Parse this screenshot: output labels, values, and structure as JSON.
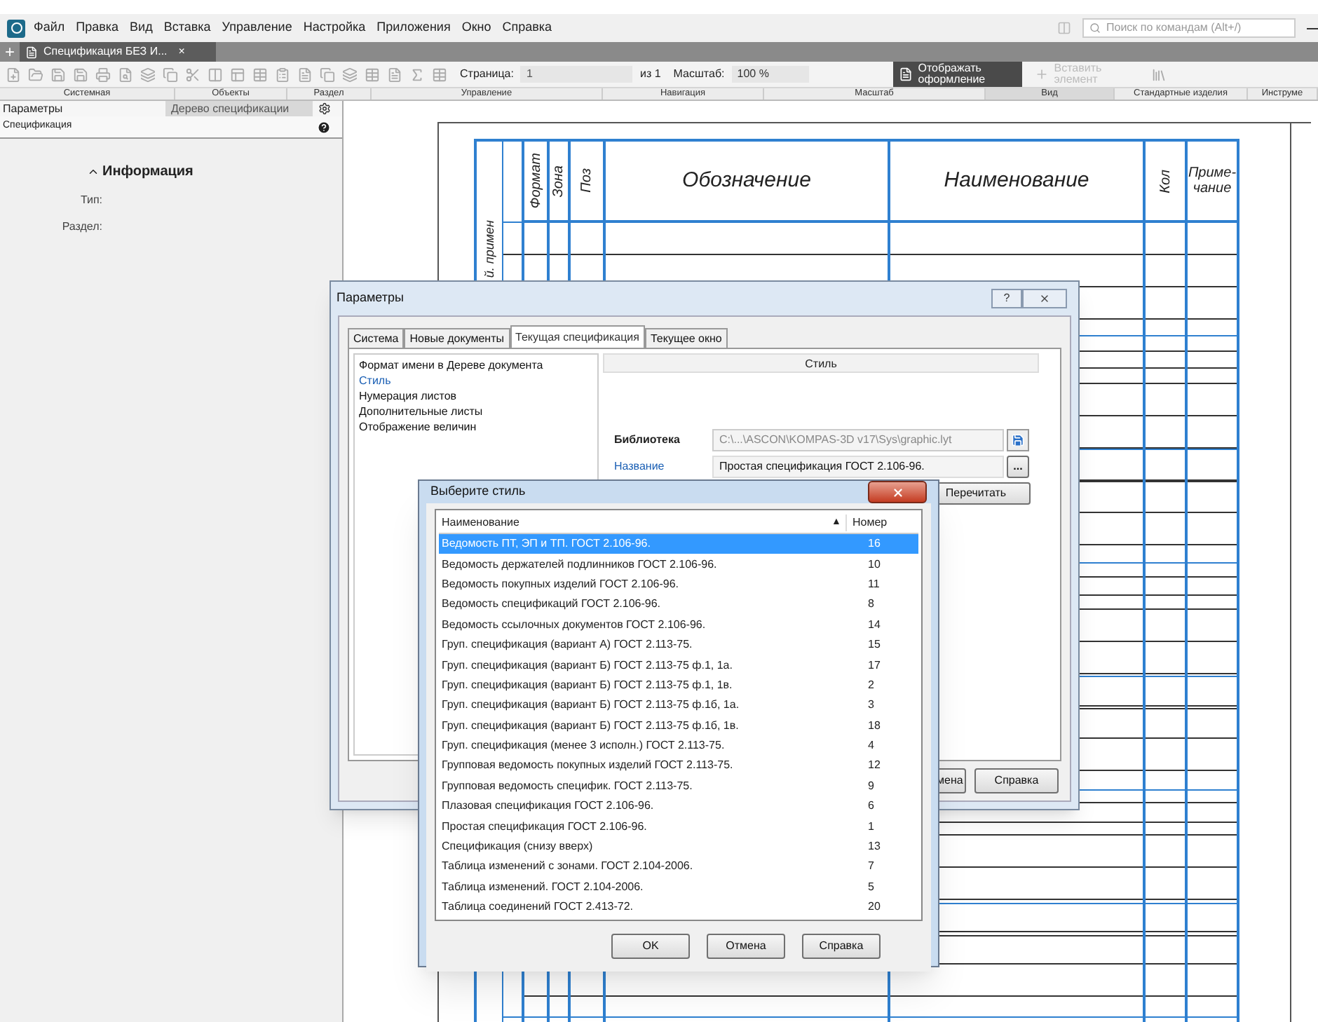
{
  "menu": [
    "Файл",
    "Правка",
    "Вид",
    "Вставка",
    "Управление",
    "Настройка",
    "Приложения",
    "Окно",
    "Справка"
  ],
  "search": {
    "placeholder": "Поиск по командам (Alt+/)"
  },
  "new_tab": "+",
  "document_tab": {
    "label": "Спецификация БЕЗ И...",
    "close": "×",
    "selected": true
  },
  "toolbar": {
    "page_label": "Страница:",
    "page_value": "1",
    "page_total": "из 1",
    "scale_label": "Масштаб:",
    "scale_value": "100 %",
    "show_design": {
      "label": "Отображать оформление",
      "on": true
    },
    "insert_element": {
      "label": "Вставить элемент",
      "disabled": true
    },
    "groups": [
      "Системная",
      "Объекты",
      "Раздел",
      "Управление",
      "Навигация",
      "Масштаб",
      "Вид",
      "Стандартные изделия",
      "Инструме"
    ]
  },
  "left_panel": {
    "title": "Параметры",
    "tree_tab": "Дерево спецификации",
    "object": "Спецификация",
    "section": "Информация",
    "fields": [
      "Тип:",
      "Раздел:"
    ]
  },
  "sheet": {
    "side_label": "й. примен",
    "columns": [
      {
        "kind": "vertical",
        "lines": [
          "Формат"
        ]
      },
      {
        "kind": "vertical",
        "lines": [
          "Зона"
        ]
      },
      {
        "kind": "vertical",
        "lines": [
          "Поз"
        ]
      },
      {
        "kind": "horizontal",
        "lines": [
          "Обозначение"
        ]
      },
      {
        "kind": "horizontal",
        "lines": [
          "Наименование"
        ]
      },
      {
        "kind": "vertical",
        "lines": [
          "Кол"
        ]
      },
      {
        "kind": "horizontal",
        "lines": [
          "Приме-",
          "чание"
        ]
      }
    ]
  },
  "parameters_dialog": {
    "title": "Параметры",
    "help": "?",
    "tabs": [
      {
        "label": "Система",
        "selected": false
      },
      {
        "label": "Новые документы",
        "selected": false
      },
      {
        "label": "Текущая спецификация",
        "selected": true
      },
      {
        "label": "Текущее окно",
        "selected": false
      }
    ],
    "tree": [
      {
        "label": "Формат имени в Дереве документа",
        "selected": false
      },
      {
        "label": "Стиль",
        "selected": true
      },
      {
        "label": "Нумерация листов",
        "selected": false
      },
      {
        "label": "Дополнительные листы",
        "selected": false
      },
      {
        "label": "Отображение величин",
        "selected": false
      }
    ],
    "section_title": "Стиль",
    "library": {
      "label": "Библиотека",
      "value": "C:\\...\\ASCON\\KOMPAS-3D v17\\Sys\\graphic.lyt"
    },
    "name": {
      "label": "Название",
      "value": "Простая спецификация ГОСТ 2.106-96.",
      "button": "..."
    },
    "reread": "Перечитать",
    "buttons": [
      "мена",
      "Справка"
    ]
  },
  "style_dialog": {
    "title": "Выберите стиль",
    "columns": [
      "Наименование",
      "Номер"
    ],
    "sort": "▲",
    "rows": [
      {
        "name": "Ведомость ПТ, ЭП и ТП.  ГОСТ 2.106-96.",
        "number": "16",
        "selected": true
      },
      {
        "name": "Ведомость держателей подлинников ГОСТ 2.106-96.",
        "number": "10",
        "selected": false
      },
      {
        "name": "Ведомость покупных изделий ГОСТ 2.106-96.",
        "number": "11",
        "selected": false
      },
      {
        "name": "Ведомость спецификаций ГОСТ 2.106-96.",
        "number": "8",
        "selected": false
      },
      {
        "name": "Ведомость ссылочных документов ГОСТ 2.106-96.",
        "number": "14",
        "selected": false
      },
      {
        "name": "Груп. спецификация (вариант А) ГОСТ 2.113-75.",
        "number": "15",
        "selected": false
      },
      {
        "name": "Груп. спецификация (вариант Б) ГОСТ 2.113-75 ф.1, 1а.",
        "number": "17",
        "selected": false
      },
      {
        "name": "Груп. спецификация (вариант Б) ГОСТ 2.113-75 ф.1, 1в.",
        "number": "2",
        "selected": false
      },
      {
        "name": "Груп. спецификация (вариант Б) ГОСТ 2.113-75 ф.1б, 1а.",
        "number": "3",
        "selected": false
      },
      {
        "name": "Груп. спецификация (вариант Б) ГОСТ 2.113-75 ф.1б, 1в.",
        "number": "18",
        "selected": false
      },
      {
        "name": "Груп. спецификация (менее 3 исполн.) ГОСТ 2.113-75.",
        "number": "4",
        "selected": false
      },
      {
        "name": "Групповая ведомость покупных изделий ГОСТ 2.113-75.",
        "number": "12",
        "selected": false
      },
      {
        "name": "Групповая ведомость специфик. ГОСТ 2.113-75.",
        "number": "9",
        "selected": false
      },
      {
        "name": "Плазовая спецификация ГОСТ 2.106-96.",
        "number": "6",
        "selected": false
      },
      {
        "name": "Простая спецификация ГОСТ 2.106-96.",
        "number": "1",
        "selected": false
      },
      {
        "name": "Спецификация (снизу вверх)",
        "number": "13",
        "selected": false
      },
      {
        "name": "Таблица изменений с зонами. ГОСТ 2.104-2006.",
        "number": "7",
        "selected": false
      },
      {
        "name": "Таблица изменений. ГОСТ 2.104-2006.",
        "number": "5",
        "selected": false
      },
      {
        "name": "Таблица соединений ГОСТ 2.413-72.",
        "number": "20",
        "selected": false
      }
    ],
    "buttons": [
      "OK",
      "Отмена",
      "Справка"
    ]
  }
}
